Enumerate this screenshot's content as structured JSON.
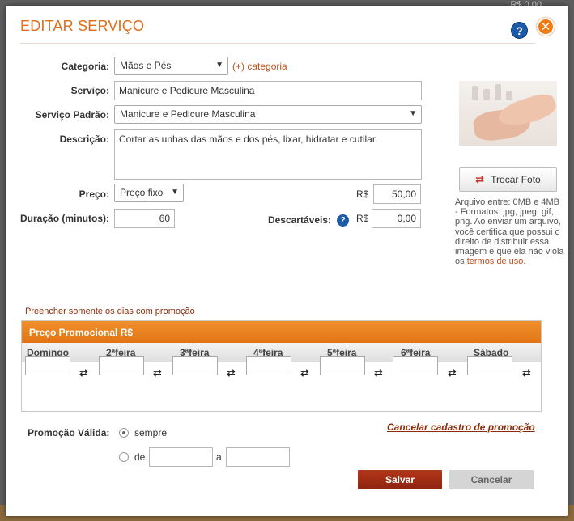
{
  "background": {
    "peek_text": "R$ 0,00"
  },
  "modal": {
    "title": "EDITAR SERVIÇO",
    "help_icon": "?",
    "close_icon": "✕"
  },
  "colors": {
    "accent": "#e06d1a",
    "save": "#a12d14",
    "link": "#c0501a"
  },
  "form": {
    "category_label": "Categoria:",
    "category_value": "Mãos e Pés",
    "add_category_link": "(+) categoria",
    "service_label": "Serviço:",
    "service_value": "Manicure e Pedicure Masculina",
    "standard_service_label": "Serviço Padrão:",
    "standard_service_value": "Manicure e Pedicure Masculina",
    "description_label": "Descrição:",
    "description_value": "Cortar as unhas das mãos e dos pés, lixar, hidratar e cutilar.",
    "price_label": "Preço:",
    "price_type_value": "Preço fixo",
    "currency": "R$",
    "price_value": "50,00",
    "duration_label": "Duração (minutos):",
    "duration_value": "60",
    "disposables_label": "Descartáveis:",
    "disposables_currency": "R$",
    "disposables_value": "0,00"
  },
  "photo": {
    "change_button": "Trocar Foto",
    "note": "Arquivo entre: 0MB e 4MB - Formatos: jpg, jpeg, gif, png. Ao enviar um arquivo, você certifica que possui o direito de distribuir essa imagem e que ela não viola os ",
    "terms_link": "termos de uso",
    "note_end": "."
  },
  "promo": {
    "note": "Preencher somente os dias com promoção",
    "table_title": "Preço Promocional R$",
    "days": [
      "Domingo",
      "2ªfeira",
      "3ªfeira",
      "4ªfeira",
      "5ªfeira",
      "6ªfeira",
      "Sábado"
    ],
    "valid_label": "Promoção Válida:",
    "option_always": "sempre",
    "option_from": "de",
    "option_to": "a",
    "cancel_link": "Cancelar cadastro de promoção",
    "selected_option": "sempre"
  },
  "actions": {
    "save": "Salvar",
    "cancel": "Cancelar"
  }
}
